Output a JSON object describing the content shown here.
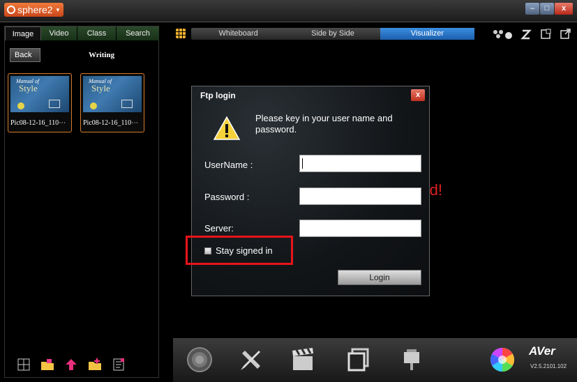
{
  "app": {
    "title": "sphere2"
  },
  "window": {
    "minimize": "–",
    "maximize": "□",
    "close": "x"
  },
  "left_panel": {
    "tabs": [
      {
        "label": "Image",
        "active": true
      },
      {
        "label": "Video",
        "active": false
      },
      {
        "label": "Class",
        "active": false
      },
      {
        "label": "Search",
        "active": false
      }
    ],
    "back_label": "Back",
    "folder_label": "Writing",
    "thumbnails": [
      {
        "caption": "Pic08-12-16_110⋯",
        "cover_title": "Manual of",
        "cover_word": "Style"
      },
      {
        "caption": "Pic08-12-16_110⋯",
        "cover_title": "Manual of",
        "cover_word": "Style"
      }
    ],
    "tools": [
      "layout-icon",
      "folder-icon",
      "upload-arrow-icon",
      "new-folder-icon",
      "notes-icon"
    ]
  },
  "top_nav": {
    "modes": [
      {
        "label": "Whiteboard",
        "active": false
      },
      {
        "label": "Side by Side",
        "active": false
      },
      {
        "label": "Visualizer",
        "active": true
      }
    ],
    "icons": [
      "people-share-icon",
      "sleep-icon",
      "capture-icon",
      "external-icon"
    ]
  },
  "main": {
    "status_text": "Not connected!"
  },
  "dialog": {
    "title": "Ftp login",
    "close": "x",
    "message": "Please key in your user name and password.",
    "username_label": "UserName :",
    "username_value": "",
    "password_label": "Password :",
    "password_value": "",
    "server_label": "Server:",
    "server_value": "",
    "stay_signed_label": "Stay signed in",
    "stay_signed_checked": false,
    "login_label": "Login"
  },
  "bottom_bar": {
    "tools": [
      "camera-lens-icon",
      "tools-icon",
      "clapper-icon",
      "photos-icon",
      "presenter-icon",
      "color-wheel-icon"
    ],
    "brand": "AVer",
    "version": "V2.5.2101.102"
  },
  "colors": {
    "accent_orange": "#d67a2a",
    "active_mode_blue": "#2b7ad0",
    "alert_red": "#e02020",
    "highlight_red": "#e8141a"
  }
}
